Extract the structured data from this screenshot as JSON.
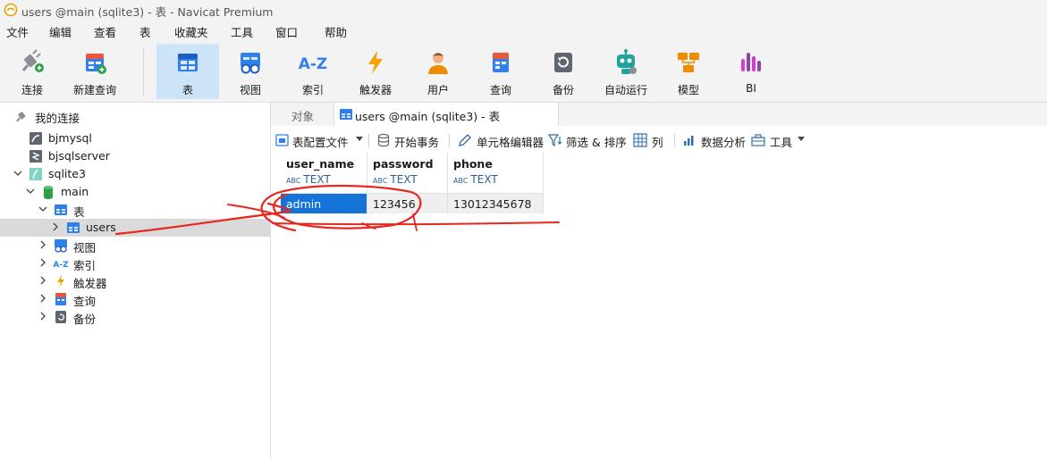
{
  "window": {
    "title": "users @main (sqlite3) - 表 - Navicat Premium"
  },
  "menu": [
    "文件",
    "编辑",
    "查看",
    "表",
    "收藏夹",
    "工具",
    "窗口",
    "帮助"
  ],
  "toolbar": {
    "connect": "连接",
    "new_query": "新建查询",
    "table": "表",
    "view": "视图",
    "index": "索引",
    "trigger": "触发器",
    "user": "用户",
    "query": "查询",
    "backup": "备份",
    "automation": "自动运行",
    "model": "模型",
    "bi": "BI",
    "index_icon_text": "A-Z"
  },
  "sidebar": {
    "root": "我的连接",
    "connections": [
      "bjmysql",
      "bjsqlserver",
      "sqlite3"
    ],
    "database": "main",
    "table_group": "表",
    "table_item": "users",
    "other_groups": [
      "视图",
      "索引",
      "触发器",
      "查询",
      "备份"
    ],
    "index_icon_text": "A-Z"
  },
  "tabs": {
    "objects": "对象",
    "active": "users @main (sqlite3) - 表"
  },
  "subtoolbar": {
    "table_profile": "表配置文件",
    "begin_transaction": "开始事务",
    "cell_editor": "单元格编辑器",
    "filter_sort": "筛选 & 排序",
    "columns": "列",
    "data_analysis": "数据分析",
    "tools": "工具"
  },
  "grid": {
    "columns": [
      {
        "name": "user_name",
        "type": "TEXT"
      },
      {
        "name": "password",
        "type": "TEXT"
      },
      {
        "name": "phone",
        "type": "TEXT"
      }
    ],
    "rows": [
      [
        "admin",
        "123456",
        "13012345678"
      ]
    ],
    "type_prefix": "ABC"
  },
  "colors": {
    "accent": "#1373d6",
    "selection": "#cde3f7",
    "annotation": "#e8271f"
  }
}
